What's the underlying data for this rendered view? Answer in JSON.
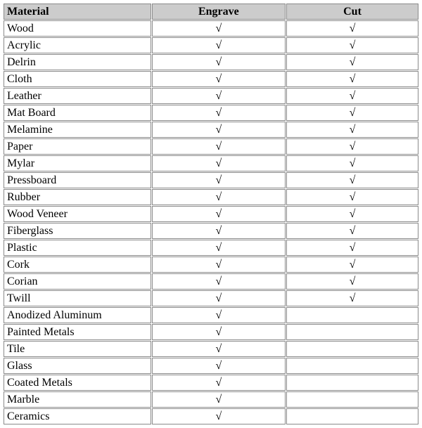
{
  "headers": {
    "material": "Material",
    "engrave": "Engrave",
    "cut": "Cut"
  },
  "check_symbol": "√",
  "rows": [
    {
      "material": "Wood",
      "engrave": true,
      "cut": true
    },
    {
      "material": "Acrylic",
      "engrave": true,
      "cut": true
    },
    {
      "material": "Delrin",
      "engrave": true,
      "cut": true
    },
    {
      "material": "Cloth",
      "engrave": true,
      "cut": true
    },
    {
      "material": "Leather",
      "engrave": true,
      "cut": true
    },
    {
      "material": "Mat Board",
      "engrave": true,
      "cut": true
    },
    {
      "material": "Melamine",
      "engrave": true,
      "cut": true
    },
    {
      "material": "Paper",
      "engrave": true,
      "cut": true
    },
    {
      "material": "Mylar",
      "engrave": true,
      "cut": true
    },
    {
      "material": "Pressboard",
      "engrave": true,
      "cut": true
    },
    {
      "material": "Rubber",
      "engrave": true,
      "cut": true
    },
    {
      "material": "Wood Veneer",
      "engrave": true,
      "cut": true
    },
    {
      "material": "Fiberglass",
      "engrave": true,
      "cut": true
    },
    {
      "material": "Plastic",
      "engrave": true,
      "cut": true
    },
    {
      "material": "Cork",
      "engrave": true,
      "cut": true
    },
    {
      "material": "Corian",
      "engrave": true,
      "cut": true
    },
    {
      "material": "Twill",
      "engrave": true,
      "cut": true
    },
    {
      "material": "Anodized Aluminum",
      "engrave": true,
      "cut": false
    },
    {
      "material": "Painted Metals",
      "engrave": true,
      "cut": false
    },
    {
      "material": "Tile",
      "engrave": true,
      "cut": false
    },
    {
      "material": "Glass",
      "engrave": true,
      "cut": false
    },
    {
      "material": "Coated Metals",
      "engrave": true,
      "cut": false
    },
    {
      "material": "Marble",
      "engrave": true,
      "cut": false
    },
    {
      "material": "Ceramics",
      "engrave": true,
      "cut": false
    }
  ]
}
